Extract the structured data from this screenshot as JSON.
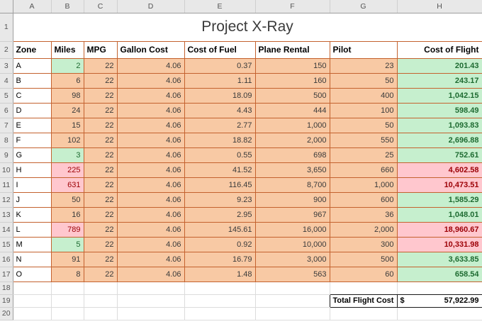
{
  "title": "Project X-Ray",
  "grid": {
    "columns": [
      "A",
      "B",
      "C",
      "D",
      "E",
      "F",
      "G",
      "H"
    ],
    "rows": [
      "1",
      "2",
      "3",
      "4",
      "5",
      "6",
      "7",
      "8",
      "9",
      "10",
      "11",
      "12",
      "13",
      "14",
      "15",
      "16",
      "17",
      "18",
      "19",
      "20"
    ]
  },
  "table": {
    "headers": [
      "Zone",
      "Miles",
      "MPG",
      "Gallon Cost",
      "Cost of Fuel",
      "Plane Rental",
      "Pilot",
      "Cost of Flight"
    ],
    "rows": [
      {
        "zone": "A",
        "miles": "2",
        "mpg": "22",
        "gallon_cost": "4.06",
        "cost_of_fuel": "0.37",
        "plane_rental": "150",
        "pilot": "23",
        "cost_of_flight": "201.43",
        "miles_state": "green",
        "flight_state": "green"
      },
      {
        "zone": "B",
        "miles": "6",
        "mpg": "22",
        "gallon_cost": "4.06",
        "cost_of_fuel": "1.11",
        "plane_rental": "160",
        "pilot": "50",
        "cost_of_flight": "243.17",
        "miles_state": "orange",
        "flight_state": "green"
      },
      {
        "zone": "C",
        "miles": "98",
        "mpg": "22",
        "gallon_cost": "4.06",
        "cost_of_fuel": "18.09",
        "plane_rental": "500",
        "pilot": "400",
        "cost_of_flight": "1,042.15",
        "miles_state": "orange",
        "flight_state": "green"
      },
      {
        "zone": "D",
        "miles": "24",
        "mpg": "22",
        "gallon_cost": "4.06",
        "cost_of_fuel": "4.43",
        "plane_rental": "444",
        "pilot": "100",
        "cost_of_flight": "598.49",
        "miles_state": "orange",
        "flight_state": "green"
      },
      {
        "zone": "E",
        "miles": "15",
        "mpg": "22",
        "gallon_cost": "4.06",
        "cost_of_fuel": "2.77",
        "plane_rental": "1,000",
        "pilot": "50",
        "cost_of_flight": "1,093.83",
        "miles_state": "orange",
        "flight_state": "green"
      },
      {
        "zone": "F",
        "miles": "102",
        "mpg": "22",
        "gallon_cost": "4.06",
        "cost_of_fuel": "18.82",
        "plane_rental": "2,000",
        "pilot": "550",
        "cost_of_flight": "2,696.88",
        "miles_state": "orange",
        "flight_state": "green"
      },
      {
        "zone": "G",
        "miles": "3",
        "mpg": "22",
        "gallon_cost": "4.06",
        "cost_of_fuel": "0.55",
        "plane_rental": "698",
        "pilot": "25",
        "cost_of_flight": "752.61",
        "miles_state": "green",
        "flight_state": "green"
      },
      {
        "zone": "H",
        "miles": "225",
        "mpg": "22",
        "gallon_cost": "4.06",
        "cost_of_fuel": "41.52",
        "plane_rental": "3,650",
        "pilot": "660",
        "cost_of_flight": "4,602.58",
        "miles_state": "pink",
        "flight_state": "pink"
      },
      {
        "zone": "I",
        "miles": "631",
        "mpg": "22",
        "gallon_cost": "4.06",
        "cost_of_fuel": "116.45",
        "plane_rental": "8,700",
        "pilot": "1,000",
        "cost_of_flight": "10,473.51",
        "miles_state": "pink",
        "flight_state": "pink"
      },
      {
        "zone": "J",
        "miles": "50",
        "mpg": "22",
        "gallon_cost": "4.06",
        "cost_of_fuel": "9.23",
        "plane_rental": "900",
        "pilot": "600",
        "cost_of_flight": "1,585.29",
        "miles_state": "orange",
        "flight_state": "green"
      },
      {
        "zone": "K",
        "miles": "16",
        "mpg": "22",
        "gallon_cost": "4.06",
        "cost_of_fuel": "2.95",
        "plane_rental": "967",
        "pilot": "36",
        "cost_of_flight": "1,048.01",
        "miles_state": "orange",
        "flight_state": "green"
      },
      {
        "zone": "L",
        "miles": "789",
        "mpg": "22",
        "gallon_cost": "4.06",
        "cost_of_fuel": "145.61",
        "plane_rental": "16,000",
        "pilot": "2,000",
        "cost_of_flight": "18,960.67",
        "miles_state": "pink",
        "flight_state": "pink"
      },
      {
        "zone": "M",
        "miles": "5",
        "mpg": "22",
        "gallon_cost": "4.06",
        "cost_of_fuel": "0.92",
        "plane_rental": "10,000",
        "pilot": "300",
        "cost_of_flight": "10,331.98",
        "miles_state": "green",
        "flight_state": "pink"
      },
      {
        "zone": "N",
        "miles": "91",
        "mpg": "22",
        "gallon_cost": "4.06",
        "cost_of_fuel": "16.79",
        "plane_rental": "3,000",
        "pilot": "500",
        "cost_of_flight": "3,633.85",
        "miles_state": "orange",
        "flight_state": "green"
      },
      {
        "zone": "O",
        "miles": "8",
        "mpg": "22",
        "gallon_cost": "4.06",
        "cost_of_fuel": "1.48",
        "plane_rental": "563",
        "pilot": "60",
        "cost_of_flight": "658.54",
        "miles_state": "orange",
        "flight_state": "green"
      }
    ]
  },
  "total_row": {
    "label": "Total Flight Cost",
    "currency": "$",
    "amount": "57,922.99"
  },
  "colors": {
    "fill_orange": "#F8C9A4",
    "fill_green": "#C6EFCE",
    "fill_pink": "#FFC7CE",
    "text_green": "#1E6B31",
    "text_red": "#9C0006",
    "grid_border": "#C4622F"
  }
}
